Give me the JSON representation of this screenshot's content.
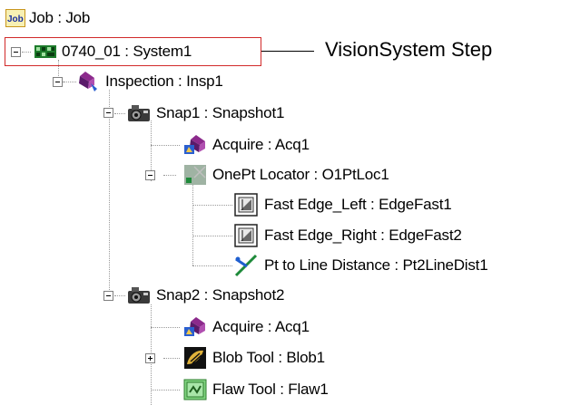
{
  "tree": {
    "root": {
      "label": "Job : Job",
      "icon": "job-icon"
    },
    "system": {
      "label": "0740_01 : System1",
      "icon": "vision-system-icon"
    },
    "inspection": {
      "label": "Inspection : Insp1",
      "icon": "inspection-icon"
    },
    "snap1": {
      "label": "Snap1 : Snapshot1",
      "icon": "camera-icon"
    },
    "snap1_acquire": {
      "label": "Acquire : Acq1",
      "icon": "acquire-icon"
    },
    "locator": {
      "label": "OnePt Locator : O1PtLoc1",
      "icon": "locator-icon"
    },
    "edge_left": {
      "label": "Fast Edge_Left : EdgeFast1",
      "icon": "edge-tool-icon"
    },
    "edge_right": {
      "label": "Fast Edge_Right : EdgeFast2",
      "icon": "edge-tool-icon"
    },
    "distance": {
      "label": "Pt to Line Distance : Pt2LineDist1",
      "icon": "distance-tool-icon"
    },
    "snap2": {
      "label": "Snap2 : Snapshot2",
      "icon": "camera-icon"
    },
    "snap2_acquire": {
      "label": "Acquire : Acq1",
      "icon": "acquire-icon"
    },
    "blob": {
      "label": "Blob Tool : Blob1",
      "icon": "blob-tool-icon"
    },
    "flaw": {
      "label": "Flaw Tool : Flaw1",
      "icon": "flaw-tool-icon"
    }
  },
  "annotation": {
    "label": "VisionSystem Step",
    "highlight_color": "#d12a2a"
  }
}
